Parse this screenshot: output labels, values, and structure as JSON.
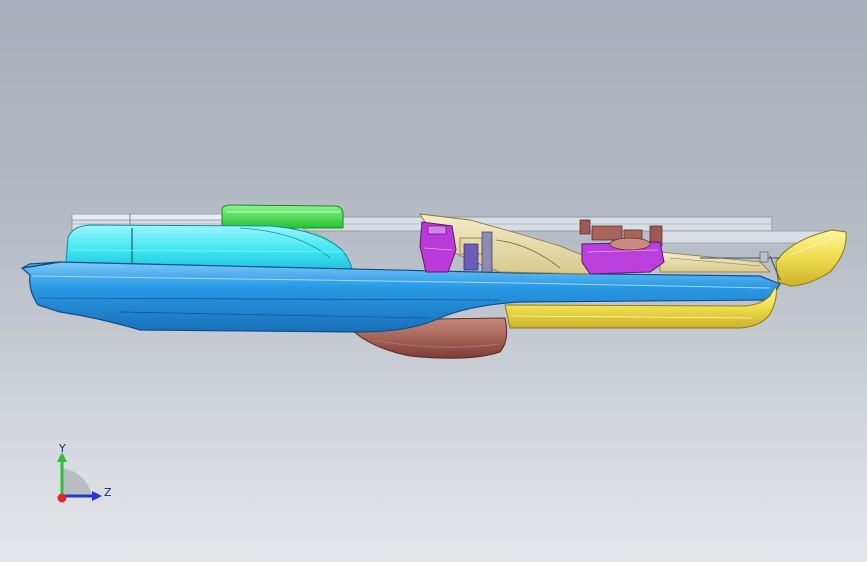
{
  "triad": {
    "y_label": "Y",
    "z_label": "Z",
    "y_color": "#2fbf3a",
    "z_color": "#2636d6",
    "x_color": "#e02a2a"
  },
  "colors": {
    "background_top": "#a7aeb9",
    "background_bottom": "#e4e6ea",
    "hull_blue": "#2f9fe8",
    "deck_cyan": "#35e3f0",
    "canopy_green": "#3fd84a",
    "keel_brown": "#a0584a",
    "stern_yellow": "#f1e35a",
    "engine_magenta": "#b93ad8",
    "frame_grey": "#d9dde4"
  }
}
